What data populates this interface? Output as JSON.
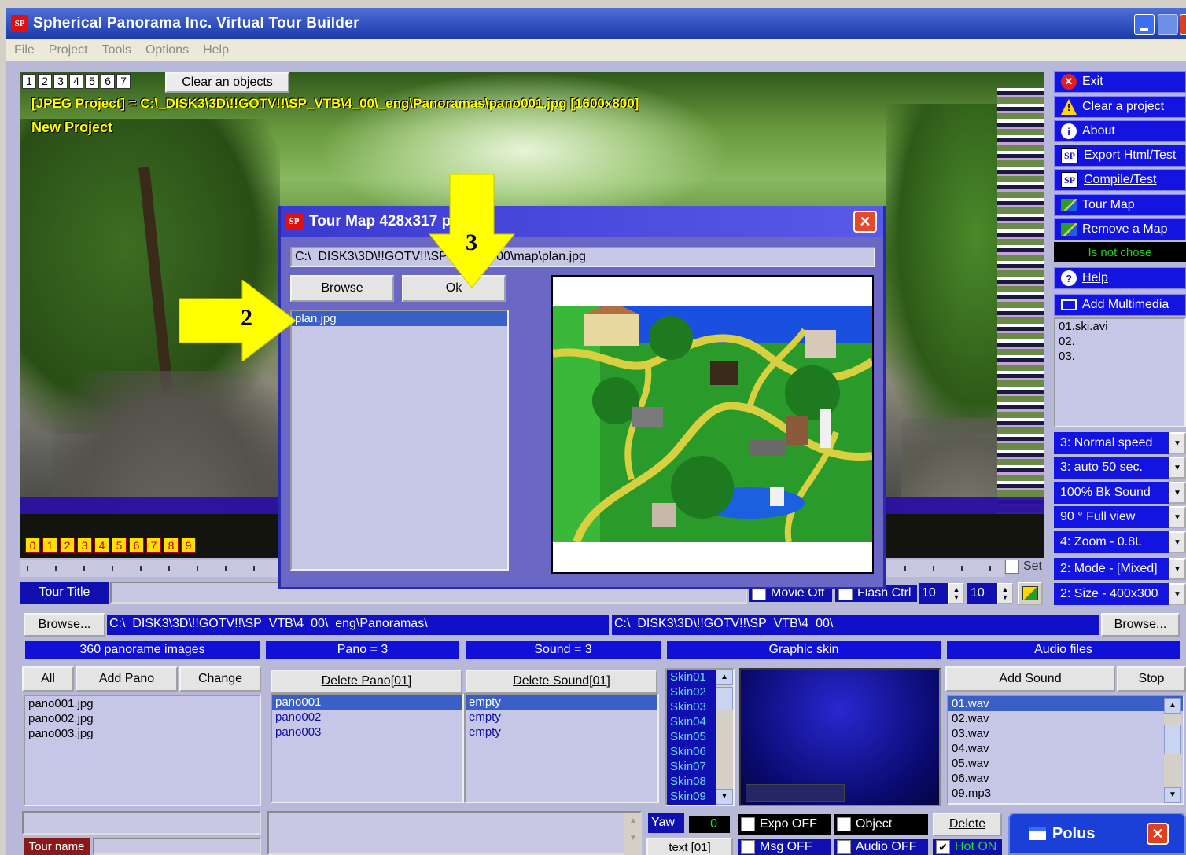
{
  "window": {
    "title": "Spherical Panorama Inc. Virtual Tour Builder",
    "icon_text": "SP"
  },
  "menu": [
    "File",
    "Project",
    "Tools",
    "Options",
    "Help"
  ],
  "viewer": {
    "object_tabs": [
      "1",
      "2",
      "3",
      "4",
      "5",
      "6",
      "7"
    ],
    "clear_objects": "Clear an objects",
    "project_path": "[JPEG Project] = C:\\_DISK3\\3D\\!!GOTV!!\\SP_VTB\\4_00\\_eng\\Panoramas\\pano001.jpg [1600x800]",
    "project_name": "New Project",
    "hotspots": [
      "0",
      "1",
      "2",
      "3",
      "4",
      "5",
      "6",
      "7",
      "8",
      "9"
    ],
    "set_label": "Set",
    "tour_title_label": "Tour Title",
    "movie_label": "Movie Off",
    "flash_label": "Flash Ctrl",
    "spin1": "10",
    "spin2": "10"
  },
  "right_panel": {
    "buttons": [
      {
        "label": "Exit",
        "icon": "exit-icon"
      },
      {
        "label": "Clear a project",
        "icon": "warning-icon"
      },
      {
        "label": "About",
        "icon": "info-icon"
      },
      {
        "label": "Export Html/Test",
        "icon": "sp-logo-icon"
      },
      {
        "label": "Compile/Test",
        "icon": "sp-logo-icon"
      },
      {
        "label": "Tour Map",
        "icon": "map-icon"
      },
      {
        "label": "Remove a Map",
        "icon": "map-icon"
      }
    ],
    "status": "Is not chose",
    "help": "Help",
    "add_multimedia": "Add Multimedia",
    "multimedia": [
      "01.ski.avi",
      "02.",
      "03."
    ],
    "dropdowns": [
      "3: Normal speed",
      "3: auto 50 sec.",
      "100% Bk Sound",
      "90 ° Full view",
      "4: Zoom - 0.8L",
      "2: Mode - [Mixed]",
      "2: Size - 400x300"
    ]
  },
  "paths": {
    "browse_left": "Browse...",
    "path_left": "C:\\_DISK3\\3D\\!!GOTV!!\\SP_VTB\\4_00\\_eng\\Panoramas\\",
    "path_right": "C:\\_DISK3\\3D\\!!GOTV!!\\SP_VTB\\4_00\\",
    "browse_right": "Browse..."
  },
  "headers": {
    "images": "360 panorame images",
    "pano": "Pano = 3",
    "sound": "Sound = 3",
    "skin": "Graphic skin",
    "audio": "Audio files"
  },
  "pano_buttons": {
    "all": "All",
    "add": "Add Pano",
    "change": "Change"
  },
  "delete_buttons": {
    "pano": "Delete Pano[01]",
    "sound": "Delete Sound[01]"
  },
  "image_files": [
    "pano001.jpg",
    "pano002.jpg",
    "pano003.jpg"
  ],
  "panos": [
    "pano001",
    "pano002",
    "pano003"
  ],
  "sounds": [
    "empty",
    "empty",
    "empty"
  ],
  "skins": [
    "Skin01",
    "Skin02",
    "Skin03",
    "Skin04",
    "Skin05",
    "Skin06",
    "Skin07",
    "Skin08",
    "Skin09"
  ],
  "audio": {
    "add": "Add Sound",
    "stop": "Stop",
    "files": [
      "01.wav",
      "02.wav",
      "03.wav",
      "04.wav",
      "05.wav",
      "06.wav",
      "09.mp3"
    ]
  },
  "bottom": {
    "tour_name": "Tour name",
    "yaw_label": "Yaw",
    "yaw_value": "0",
    "text_btn": "text [01]",
    "expo": "Expo OFF",
    "object": "Object",
    "msg": "Msg OFF",
    "audio_off": "Audio OFF",
    "delete": "Delete",
    "hot_on": "Hot ON",
    "polus": "Polus"
  },
  "dialog": {
    "title": "Tour Map 428x317 px",
    "path": "C:\\_DISK3\\3D\\!!GOTV!!\\SP_VTB\\4_00\\map\\plan.jpg",
    "browse": "Browse",
    "ok": "Ok",
    "files": [
      "plan.jpg"
    ]
  },
  "annotations": {
    "arrow2": "2",
    "arrow3": "3"
  },
  "colors": {
    "accent_blue": "#1414e0",
    "title_bar": "#0a246a",
    "dialog_bg": "#6a68c4",
    "highlight_yellow": "#ffff00"
  }
}
